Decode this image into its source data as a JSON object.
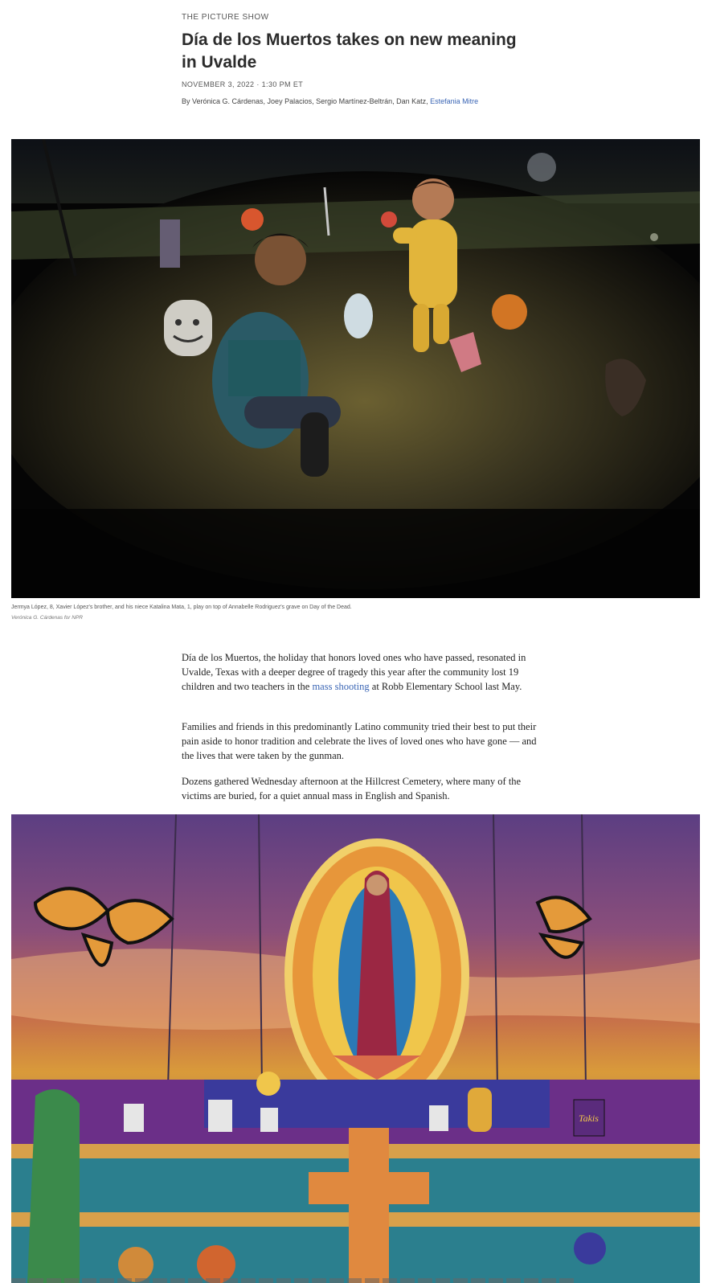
{
  "article": {
    "section": "THE PICTURE SHOW",
    "headline": "Día de los Muertos takes on new meaning in Uvalde",
    "dateline": "NOVEMBER 3, 2022 · 1:30 PM ET",
    "byline_prefix": "By Verónica G. Cárdenas, Joey Palacios, Sergio Martínez-Beltrán, Dan Katz, ",
    "byline_link": "Estefania Mitre"
  },
  "photo1": {
    "caption": "Jermya López, 8, Xavier López's brother, and his niece Katalina Mata, 1, play on top of Annabelle Rodriguez's grave on Day of the Dead.",
    "credit": "Verónica G. Cárdenas for NPR"
  },
  "body": {
    "p1_a": "Día de los Muertos, the holiday that honors loved ones who have passed, resonated in Uvalde, Texas with a deeper degree of tragedy this year after the community lost 19 children and two teachers in the ",
    "p1_link": "mass shooting",
    "p1_b": " at Robb Elementary School last May.",
    "p2": "Families and friends in this predominantly Latino community tried their best to put their pain aside to honor tradition and celebrate the lives of loved ones who have gone — and the lives that were taken by the gunman.",
    "p3": "Dozens gathered Wednesday afternoon at the Hillcrest Cemetery, where many of the victims are buried, for a quiet annual mass in English and Spanish."
  },
  "photo2": {
    "mural_label": "Takis"
  }
}
